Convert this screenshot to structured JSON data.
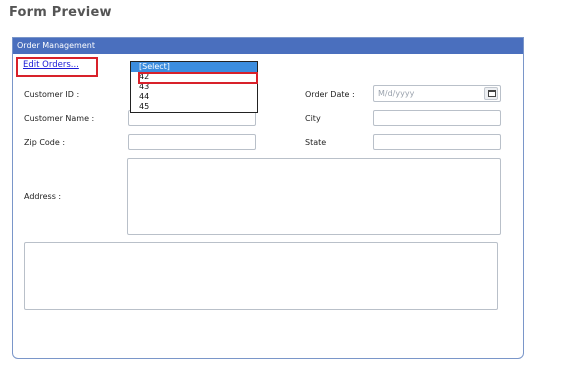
{
  "page": {
    "title": "Form Preview"
  },
  "panel": {
    "header": "Order Management"
  },
  "edit_orders": {
    "label": "Edit Orders..."
  },
  "order_dropdown": {
    "options": [
      "[Select]",
      "42",
      "43",
      "44",
      "45"
    ],
    "selected": "[Select]",
    "highlighted": "42"
  },
  "fields": {
    "customer_id": {
      "label": "Customer ID :"
    },
    "order_date": {
      "label": "Order Date :",
      "placeholder": "M/d/yyyy"
    },
    "customer_name": {
      "label": "Customer Name :"
    },
    "city": {
      "label": "City"
    },
    "zip_code": {
      "label": "Zip Code :"
    },
    "state": {
      "label": "State"
    },
    "address": {
      "label": "Address :"
    }
  },
  "colors": {
    "header_bg": "#4a6fbe",
    "highlight": "#d8212a",
    "link": "#1a1ad6",
    "select_bg": "#3c8ddf"
  },
  "icons": {
    "calendar": "calendar-icon"
  }
}
